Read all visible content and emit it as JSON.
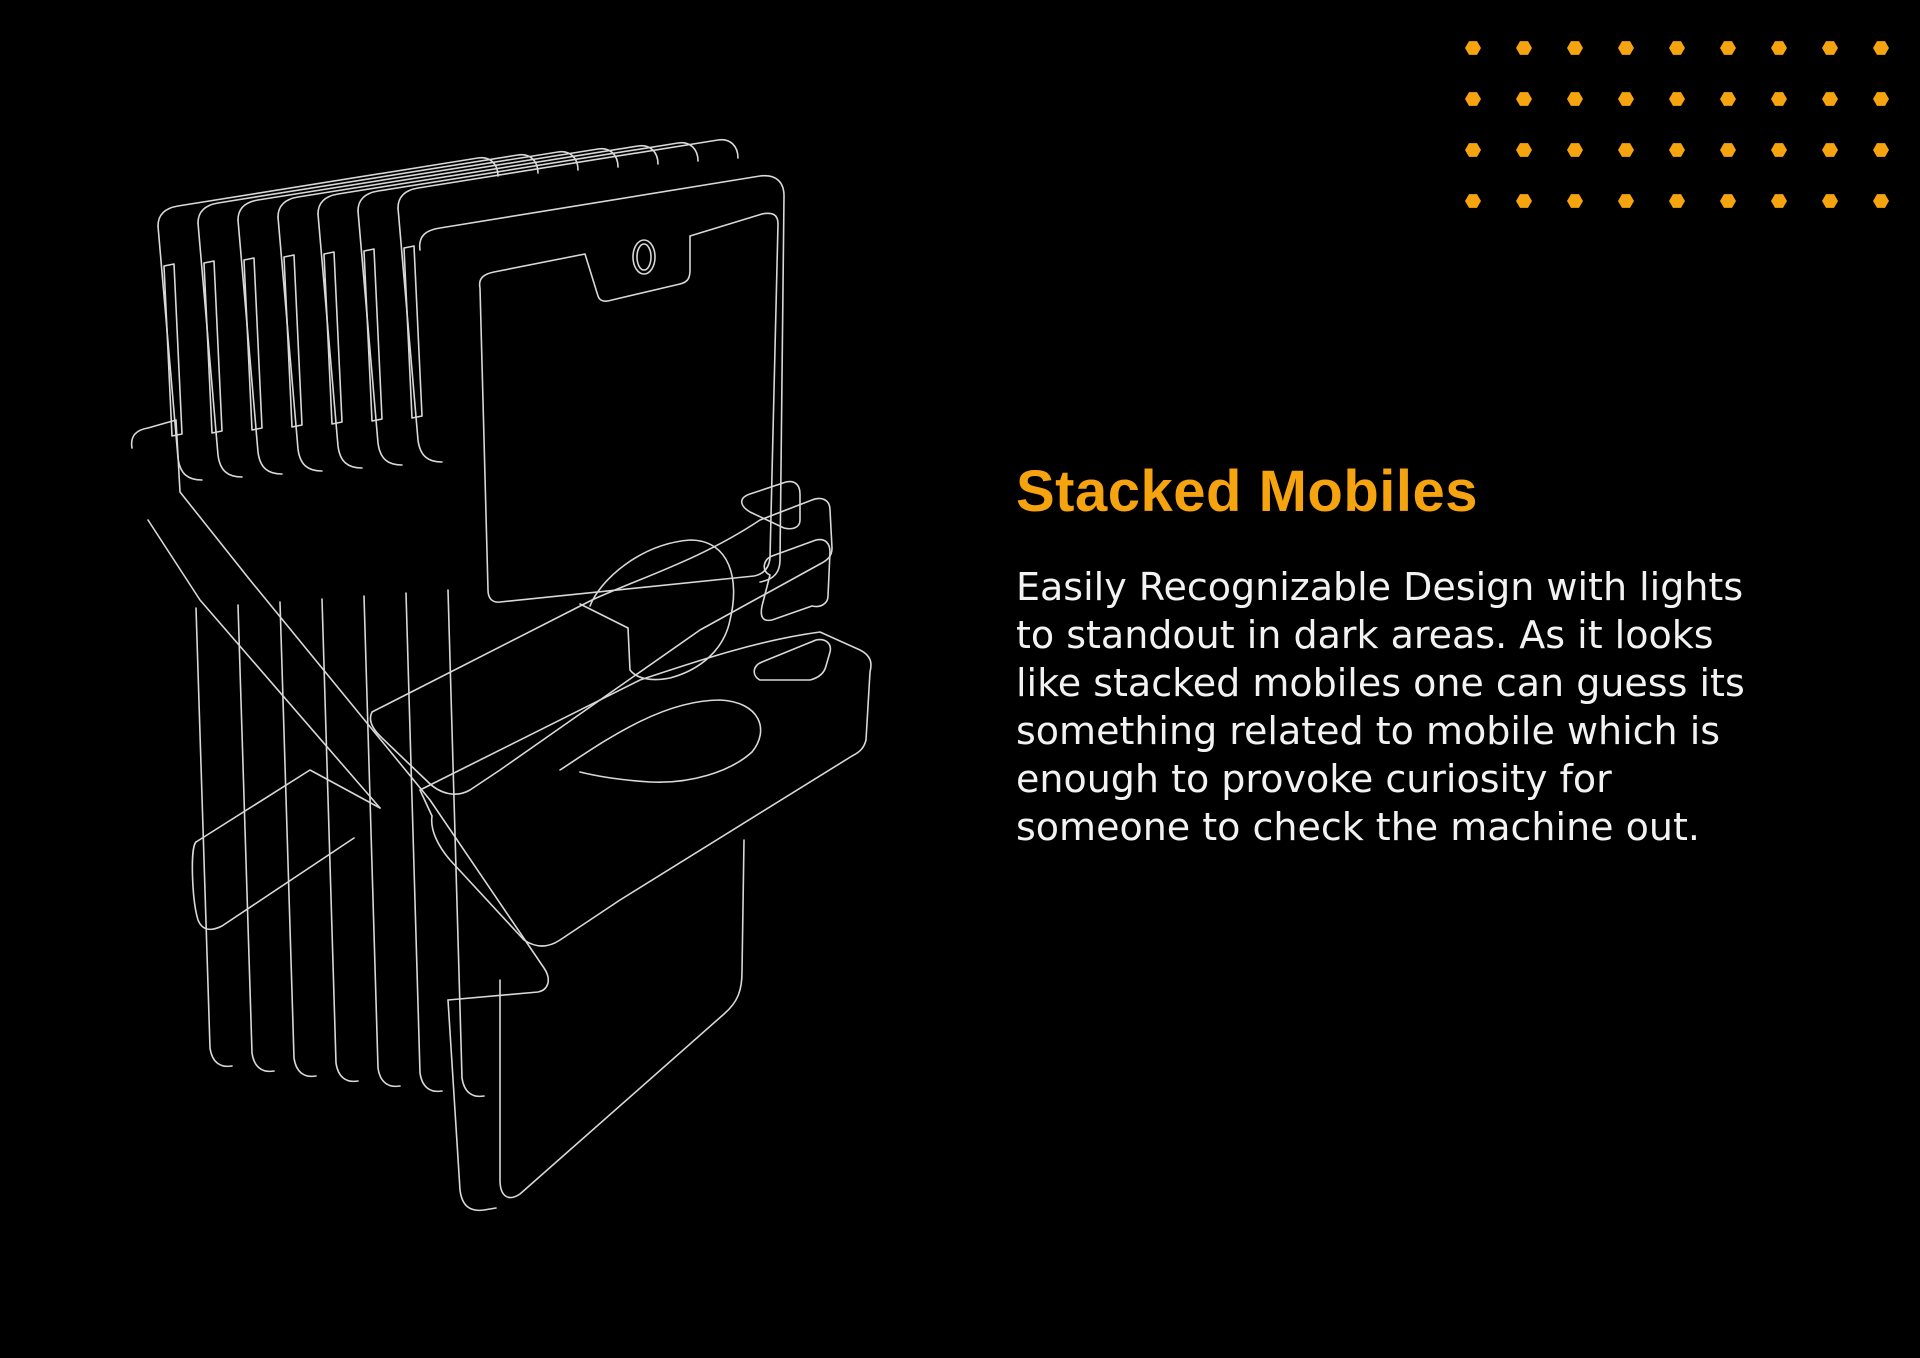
{
  "colors": {
    "background": "#000000",
    "accent": "#F5A30F",
    "text": "#F2F2F2",
    "outline": "#D8D8D8"
  },
  "illustration": {
    "icon": "stacked-mobiles-wireframe-icon"
  },
  "dot_grid": {
    "icon": "hexagon-dot-pattern-icon",
    "rows": 4,
    "columns": 9
  },
  "content": {
    "title": "Stacked Mobiles",
    "description_lines": [
      "Easily Recognizable Design with lights",
      "to standout in dark areas. As it looks",
      "like stacked mobiles one can guess its",
      "something related to mobile which is",
      "enough to provoke curiosity for",
      "someone to check the machine out."
    ]
  }
}
